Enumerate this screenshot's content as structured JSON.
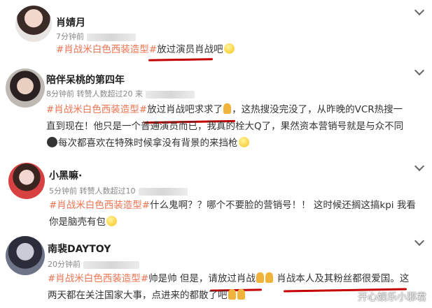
{
  "posts": [
    {
      "name": "肖婧月",
      "meta": "7分钟前",
      "tag": "#肖战米白色西装造型#",
      "rest": "放过演员肖战吧"
    },
    {
      "name": "陪伴呆桃的第四年",
      "meta": "8分钟前  转赞人数超过20  来",
      "tag": "#肖战米白色西装造型#",
      "line1": "放过肖战吧求求了",
      "line1b": "，这热搜没完没了，从昨晚的VCR热搜一",
      "line2": "直到现在！他只是一个普通演员而已，我真的栓大Q了，果然资本营销号就是与众不同",
      "line3": "每次都喜欢在特殊时候拿没有背景的来挡枪"
    },
    {
      "name": "小黑嘛·",
      "meta": "5分钟前  转赞人数超过10",
      "tag": "#肖战米白色西装造型#",
      "line1": "什么鬼啊？？哪个不要脸的营销号！！  这时候还搁这搞kpi 我看",
      "line2": "你是脑壳有包"
    },
    {
      "name": "南裴DAYTOY",
      "meta": "20分钟前",
      "tag": "#肖战米白色西装造型#",
      "line1a": "帅是帅 但是，",
      "line1b": "请放过肖战",
      "line1c": "肖战本人及其粉丝都很爱国",
      "line1d": "。这",
      "line2": "两天都在关注国家大事，点进来的都散了吧"
    }
  ],
  "watermark": "开心娱乐小邪君",
  "colors": {
    "tag": "#eb7350",
    "underline": "#c40000"
  }
}
